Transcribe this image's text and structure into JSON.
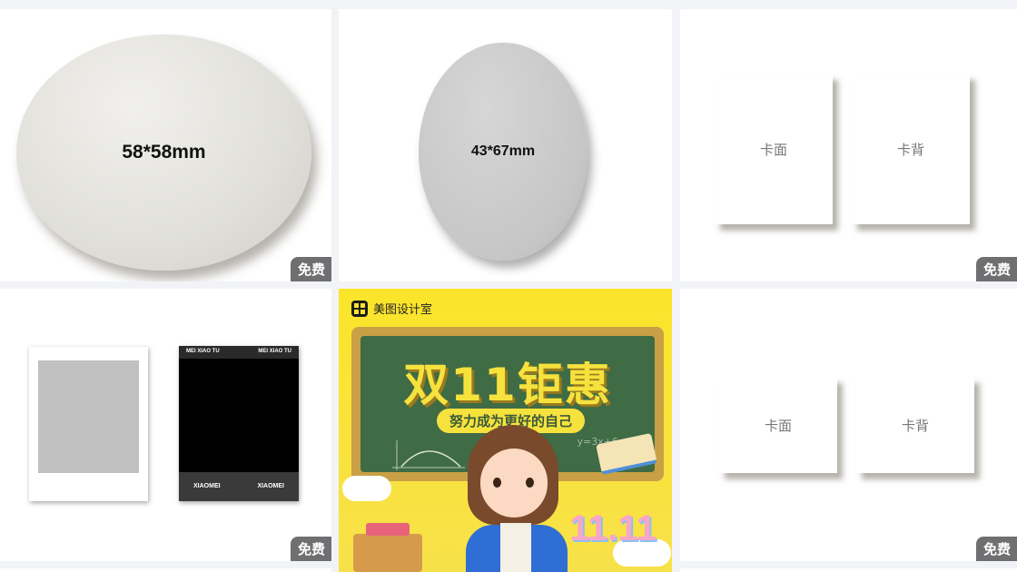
{
  "badge_free": "免费",
  "cards": {
    "c1": {
      "size_label": "58*58mm"
    },
    "c2": {
      "size_label": "43*67mm"
    },
    "c3": {
      "front_label": "卡面",
      "back_label": "卡背"
    },
    "c4": {
      "top_left": "MEI XIAO TU",
      "top_right": "MEI XIAO TU",
      "bottom_left": "XIAOMEI",
      "bottom_right": "XIAOMEI"
    },
    "c5": {
      "brand": "美图设计室",
      "headline": "双11钜惠",
      "subtitle": "努力成为更好的自己",
      "formula": "y=3x+6",
      "deco_number": "11.11"
    },
    "c6": {
      "front_label": "卡面",
      "back_label": "卡背"
    }
  },
  "colors": {
    "poster_yellow": "#f9e020",
    "board_green": "#3f6b45",
    "badge_gray": "#6f6f71"
  }
}
